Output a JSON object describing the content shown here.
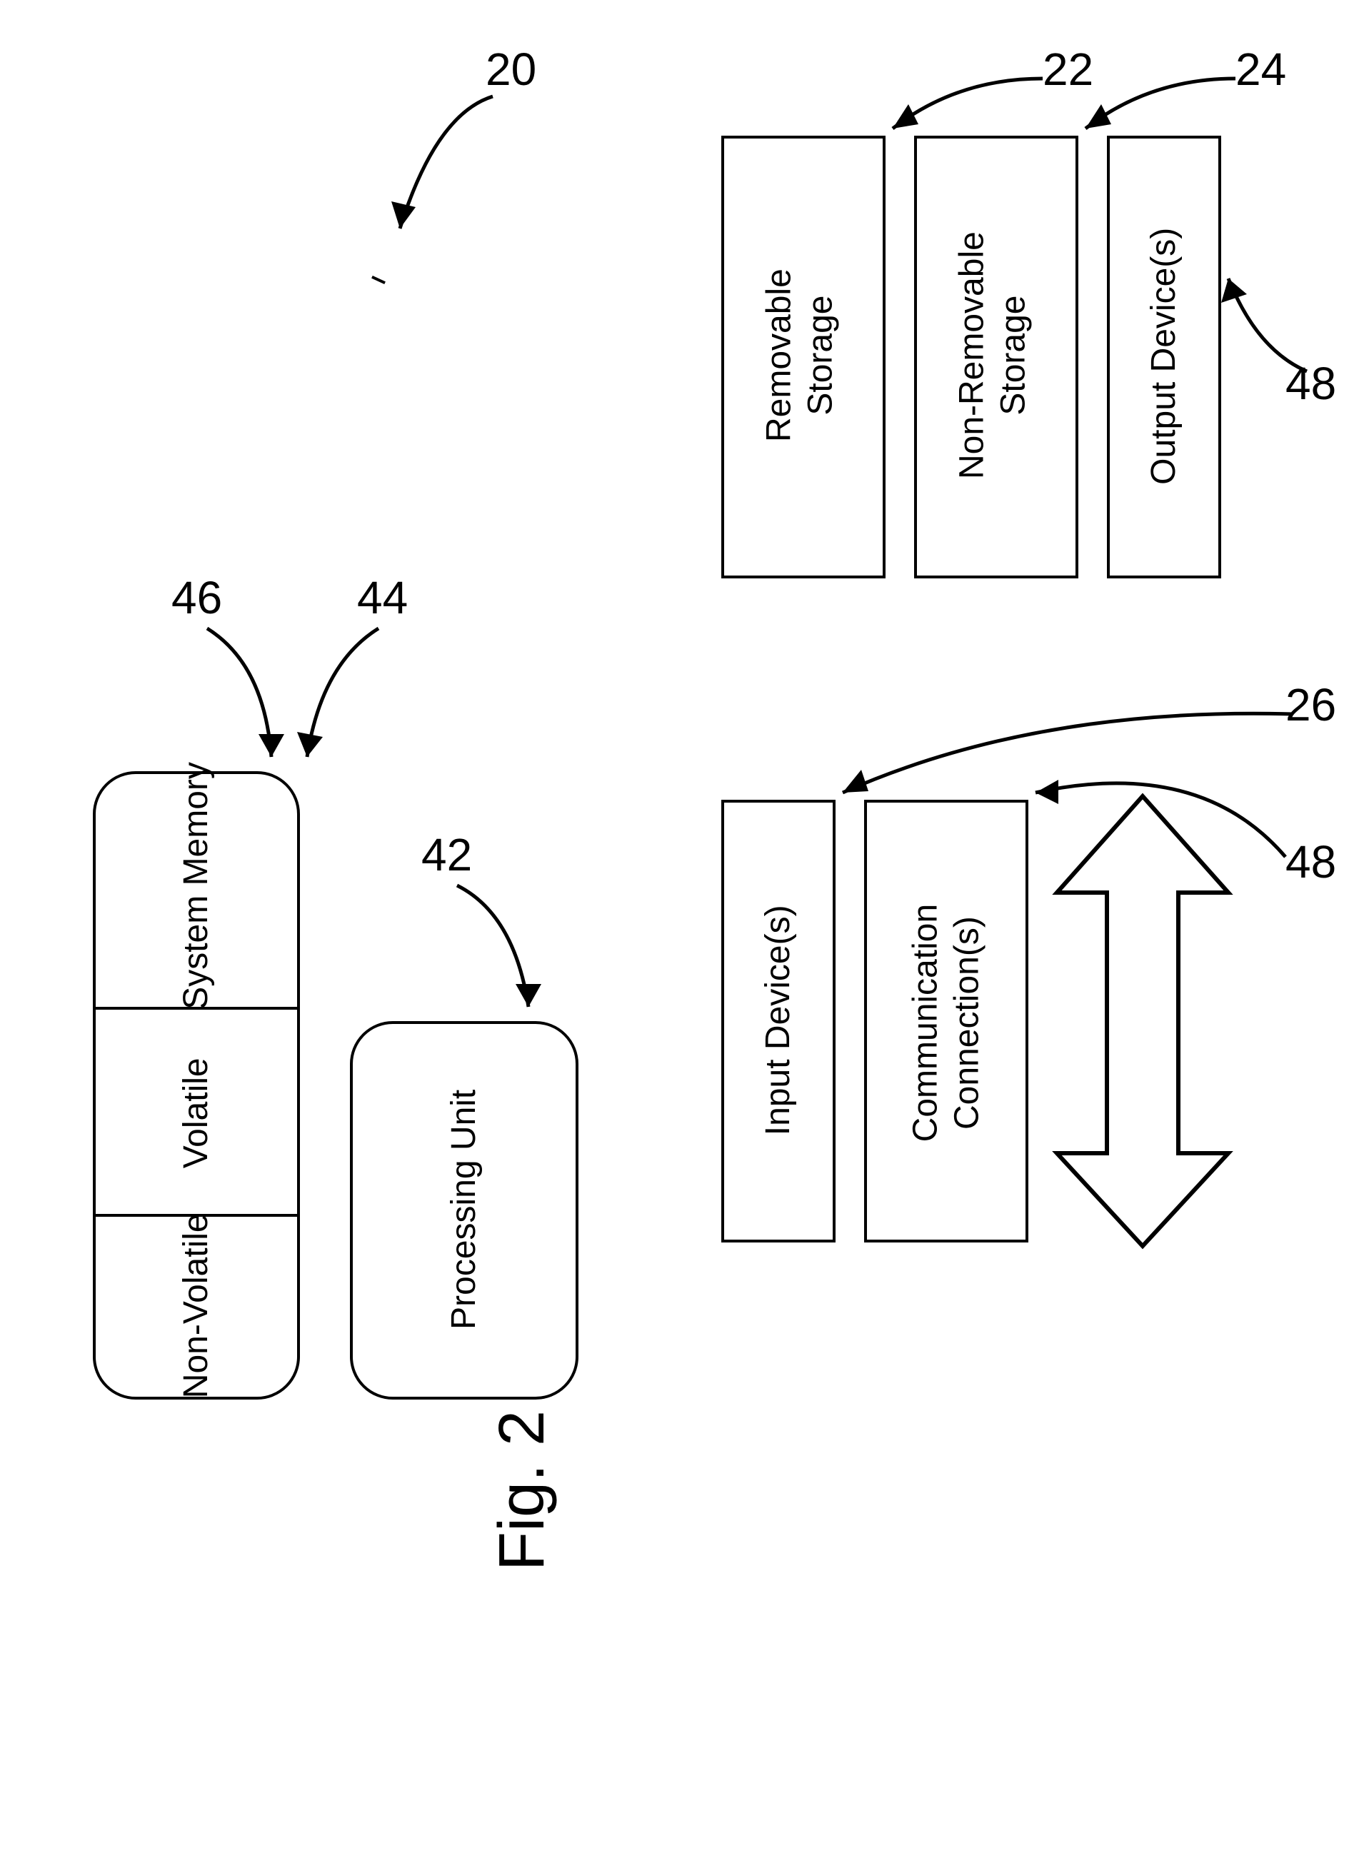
{
  "figure_label": "Fig. 2",
  "refs": {
    "r20": "20",
    "r46": "46",
    "r44": "44",
    "r42": "42",
    "r22": "22",
    "r24": "24",
    "r48a": "48",
    "r26": "26",
    "r48b": "48"
  },
  "blocks": {
    "system_memory": "System Memory",
    "volatile": "Volatile",
    "nonvolatile": "Non-Volatile",
    "processing_unit": "Processing Unit",
    "removable_storage_l1": "Removable",
    "removable_storage_l2": "Storage",
    "nonremovable_storage_l1": "Non-Removable",
    "nonremovable_storage_l2": "Storage",
    "output_devices": "Output Device(s)",
    "input_devices": "Input Device(s)",
    "comm_conn_l1": "Communication",
    "comm_conn_l2": "Connection(s)"
  }
}
